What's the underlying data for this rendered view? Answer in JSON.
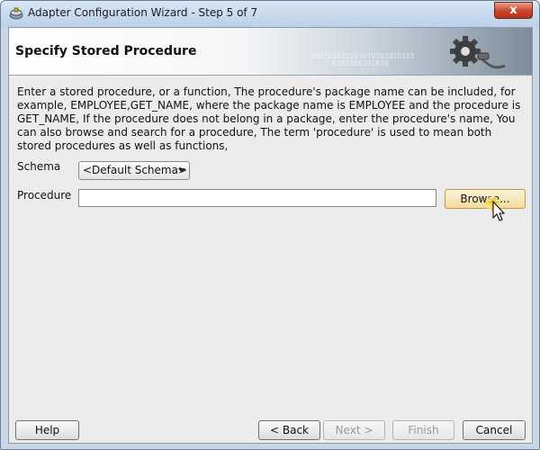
{
  "window": {
    "title": "Adapter Configuration Wizard - Step 5 of 7",
    "close_label": "x"
  },
  "header": {
    "title": "Specify Stored Procedure",
    "binary_decoration": "010101010101010101010101\n     0101010101010"
  },
  "description": "Enter a stored procedure, or a function, The procedure's package name can be included, for example, EMPLOYEE,GET_NAME, where the package name is EMPLOYEE and the procedure is GET_NAME,  If the procedure does not belong in a package, enter the procedure's name, You can also browse and search for a procedure, The term 'procedure' is used to mean both stored procedures as well as functions,",
  "form": {
    "schema_label": "Schema",
    "schema_value": "<Default Schema>",
    "procedure_label": "Procedure",
    "procedure_value": "",
    "browse_label": "Browse..."
  },
  "footer": {
    "help_label": "Help",
    "back_label": "< Back",
    "next_label": "Next >",
    "finish_label": "Finish",
    "cancel_label": "Cancel"
  },
  "icons": {
    "app": "adapter-icon",
    "header": "gear-plug-icon",
    "cursor": "mouse-pointer-icon"
  },
  "colors": {
    "titlebar": "#bcd0e8",
    "close": "#c7432b",
    "browse_highlight": "#f2dca0",
    "client_bg": "#ececec"
  }
}
